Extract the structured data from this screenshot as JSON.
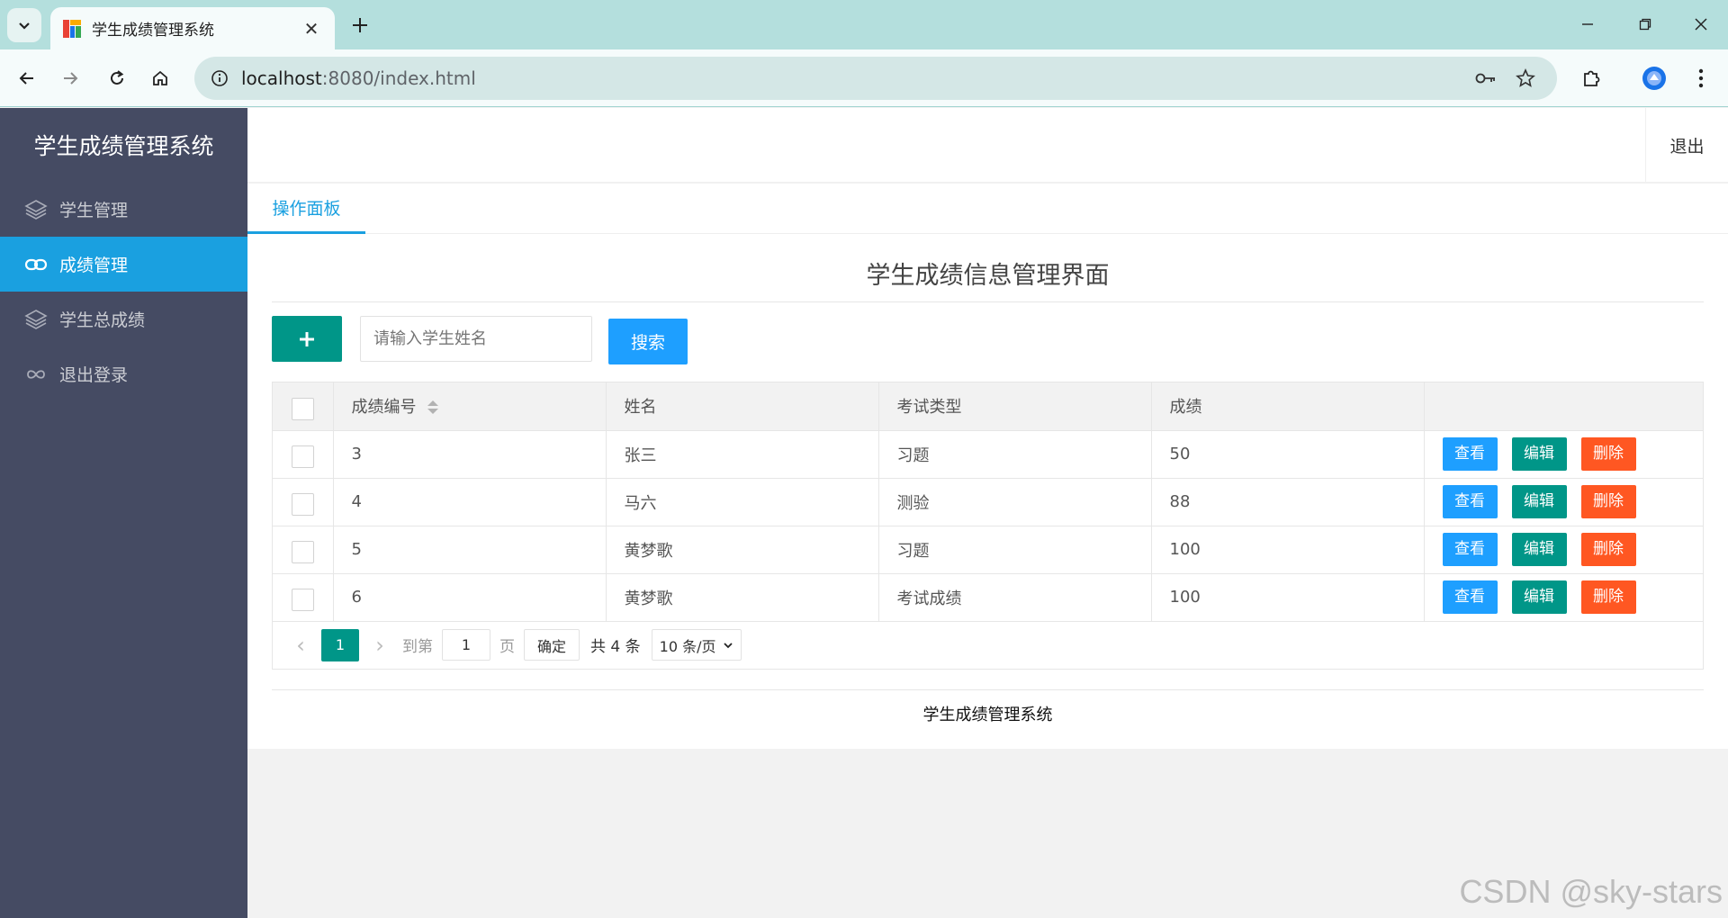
{
  "browser": {
    "tab_title": "学生成绩管理系统",
    "url_host": "localhost",
    "url_rest": ":8080/index.html",
    "new_tab_icon": "plus-icon",
    "colors": {
      "tabbar_bg": "#b4dfdd",
      "toolbar_bg": "#f5fbfb",
      "omnibox_bg": "#d4e7e6"
    }
  },
  "app": {
    "brand": "学生成绩管理系统",
    "logout_top": "退出",
    "colors": {
      "sidebar_bg": "#454b63",
      "active": "#1aa0e0",
      "green": "#009688",
      "blue": "#1e9fff",
      "red": "#ff5722"
    }
  },
  "sidebar": {
    "items": [
      {
        "label": "学生管理",
        "icon": "layers-icon",
        "active": false
      },
      {
        "label": "成绩管理",
        "icon": "link-icon",
        "active": true
      },
      {
        "label": "学生总成绩",
        "icon": "layers-icon",
        "active": false
      },
      {
        "label": "退出登录",
        "icon": "infinity-icon",
        "active": false
      }
    ]
  },
  "tabs": {
    "active_label": "操作面板"
  },
  "page": {
    "title": "学生成绩信息管理界面",
    "add_icon": "plus-icon",
    "search_placeholder": "请输入学生姓名",
    "search_button": "搜索"
  },
  "table": {
    "headers": [
      "成绩编号",
      "姓名",
      "考试类型",
      "成绩"
    ],
    "rows": [
      {
        "id": "3",
        "name": "张三",
        "type": "习题",
        "score": "50"
      },
      {
        "id": "4",
        "name": "马六",
        "type": "测验",
        "score": "88"
      },
      {
        "id": "5",
        "name": "黄梦歌",
        "type": "习题",
        "score": "100"
      },
      {
        "id": "6",
        "name": "黄梦歌",
        "type": "考试成绩",
        "score": "100"
      }
    ],
    "actions": {
      "view": "查看",
      "edit": "编辑",
      "delete": "删除"
    }
  },
  "pager": {
    "current_page": "1",
    "goto_label": "到第",
    "goto_value": "1",
    "page_label": "页",
    "confirm": "确定",
    "total": "共 4 条",
    "page_size": "10 条/页"
  },
  "footer": {
    "text": "学生成绩管理系统"
  },
  "watermark": "CSDN @sky-stars"
}
